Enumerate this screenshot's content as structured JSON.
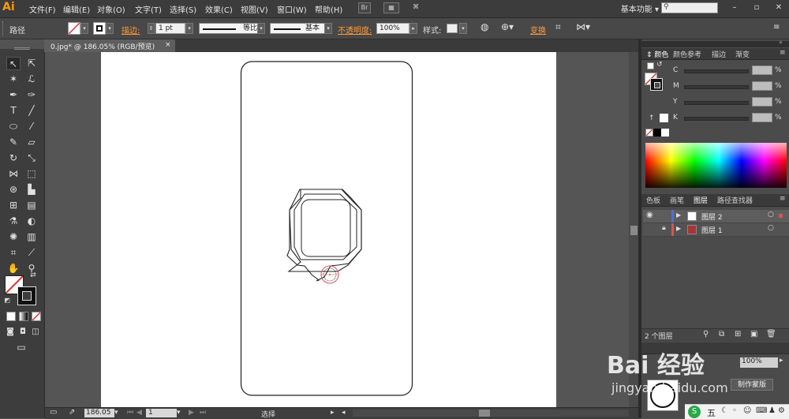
{
  "app": {
    "logo": "Ai"
  },
  "menu": [
    "文件(F)",
    "编辑(E)",
    "对象(O)",
    "文字(T)",
    "选择(S)",
    "效果(C)",
    "视图(V)",
    "窗口(W)",
    "帮助(H)"
  ],
  "menubar": {
    "br_icon": "Br",
    "workspace": "基本功能",
    "workspace_caret": "▾"
  },
  "control": {
    "object_type": "路径",
    "stroke_label": "描边:",
    "stroke_weight": "1 pt",
    "profile_uniform": "等比",
    "brush_basic": "基本",
    "opacity_label": "不透明度:",
    "opacity_value": "100%",
    "style_label": "样式:",
    "transform_label": "变换"
  },
  "document": {
    "tab_title": "0.jpg* @ 186.05% (RGB/预览)",
    "close_glyph": "×"
  },
  "status": {
    "zoom": "186.05",
    "page": "1",
    "tool_name": "选择"
  },
  "color_panel": {
    "tabs": [
      "颜色",
      "颜色参考",
      "描边",
      "渐变"
    ],
    "channels": [
      {
        "label": "C",
        "unit": "%"
      },
      {
        "label": "M",
        "unit": "%"
      },
      {
        "label": "Y",
        "unit": "%"
      },
      {
        "label": "K",
        "unit": "%"
      }
    ]
  },
  "layers_panel": {
    "tabs": [
      "色板",
      "画笔",
      "图层",
      "路径查找器"
    ],
    "layers": [
      {
        "name": "图层 2",
        "color": "#4f6fd6"
      },
      {
        "name": "图层 1",
        "color": "#d9534f"
      }
    ],
    "count_text": "2 个图层"
  },
  "transparency_panel": {
    "opacity_value": "100%",
    "mask_button": "制作蒙版"
  },
  "watermark": {
    "brand": "Bai 经验",
    "url": "jingyan.baidu.com"
  },
  "taskbar": {
    "ime": "五"
  },
  "colors": {
    "accent_orange": "#ff9a3c",
    "selection_red": "#d9534f",
    "layer_blue": "#4f6fd6"
  }
}
